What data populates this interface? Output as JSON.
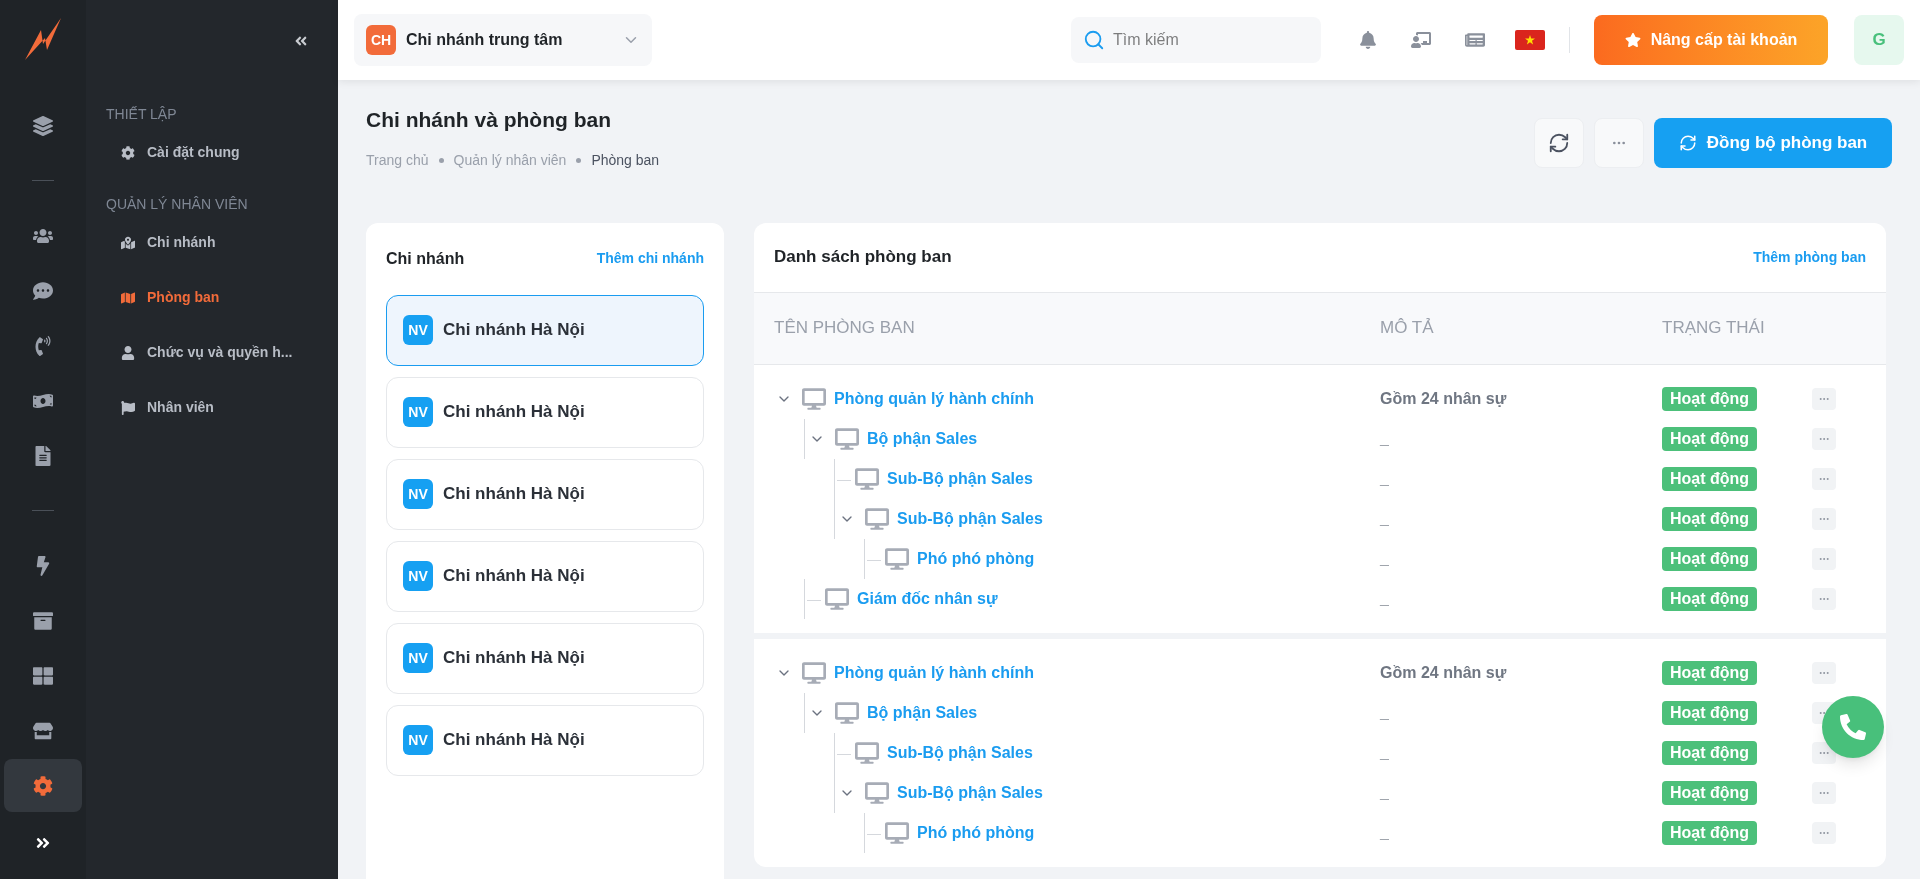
{
  "rail_items": [
    {
      "selected": false
    },
    {
      "selected": false
    },
    {
      "selected": false
    },
    {
      "selected": false
    },
    {
      "selected": false
    },
    {
      "selected": false
    },
    {
      "selected": false
    },
    {
      "selected": false
    },
    {
      "selected": false
    },
    {
      "selected": false
    },
    {
      "selected": true
    }
  ],
  "sidebar": {
    "sections": [
      {
        "title": "THIẾT LẬP",
        "items": [
          {
            "label": "Cài đặt chung",
            "selected": false
          }
        ]
      },
      {
        "title": "QUẢN LÝ NHÂN VIÊN",
        "items": [
          {
            "label": "Chi nhánh",
            "selected": false
          },
          {
            "label": "Phòng ban",
            "selected": true
          },
          {
            "label": "Chức vụ và quyền h...",
            "selected": false
          },
          {
            "label": "Nhân viên",
            "selected": false
          }
        ]
      }
    ]
  },
  "topbar": {
    "branch_badge": "CH",
    "branch_name": "Chi nhánh trung tâm",
    "search": {
      "placeholder": "Tìm kiếm"
    },
    "upgrade_button": "Nâng cấp tài khoản",
    "avatar": "G"
  },
  "page": {
    "title": "Chi nhánh và phòng ban",
    "breadcrumbs": [
      "Trang chủ",
      "Quản lý nhân viên",
      "Phòng ban"
    ],
    "sync_button": "Đồng bộ phòng ban"
  },
  "branches": {
    "title": "Chi nhánh",
    "add_link": "Thêm chi nhánh",
    "items": [
      {
        "badge": "NV",
        "name": "Chi nhánh Hà Nội",
        "selected": true
      },
      {
        "badge": "NV",
        "name": "Chi nhánh Hà Nội",
        "selected": false
      },
      {
        "badge": "NV",
        "name": "Chi nhánh Hà Nội",
        "selected": false
      },
      {
        "badge": "NV",
        "name": "Chi nhánh Hà Nội",
        "selected": false
      },
      {
        "badge": "NV",
        "name": "Chi nhánh Hà Nội",
        "selected": false
      },
      {
        "badge": "NV",
        "name": "Chi nhánh Hà Nội",
        "selected": false
      }
    ]
  },
  "departments": {
    "title": "Danh sách phòng ban",
    "add_link": "Thêm phòng ban",
    "columns": [
      "TÊN PHÒNG BAN",
      "MÔ TẢ",
      "TRẠNG THÁI"
    ],
    "groups": [
      {
        "name": "Phòng quản lý hành chính",
        "description": "Gồm 24 nhân sự",
        "status": "Hoạt động",
        "expanded": true,
        "children": [
          {
            "name": "Bộ phận Sales",
            "description": "_",
            "status": "Hoạt động",
            "expanded": true,
            "children": [
              {
                "name": "Sub-Bộ phận Sales",
                "description": "_",
                "status": "Hoạt động"
              },
              {
                "name": "Sub-Bộ phận Sales",
                "description": "_",
                "status": "Hoạt động",
                "expanded": true,
                "children": [
                  {
                    "name": "Phó phó phòng",
                    "description": "_",
                    "status": "Hoạt động"
                  }
                ]
              }
            ]
          },
          {
            "name": "Giám đốc nhân sự",
            "description": "_",
            "status": "Hoạt động"
          }
        ]
      },
      {
        "name": "Phòng quản lý hành chính",
        "description": "Gồm 24 nhân sự",
        "status": "Hoạt động",
        "expanded": true,
        "children": [
          {
            "name": "Bộ phận Sales",
            "description": "_",
            "status": "Hoạt động",
            "expanded": true,
            "children": [
              {
                "name": "Sub-Bộ phận Sales",
                "description": "_",
                "status": "Hoạt động"
              },
              {
                "name": "Sub-Bộ phận Sales",
                "description": "_",
                "status": "Hoạt động",
                "expanded": true,
                "children": [
                  {
                    "name": "Phó phó phòng",
                    "description": "_",
                    "status": "Hoạt động"
                  }
                ]
              }
            ]
          }
        ]
      }
    ]
  }
}
